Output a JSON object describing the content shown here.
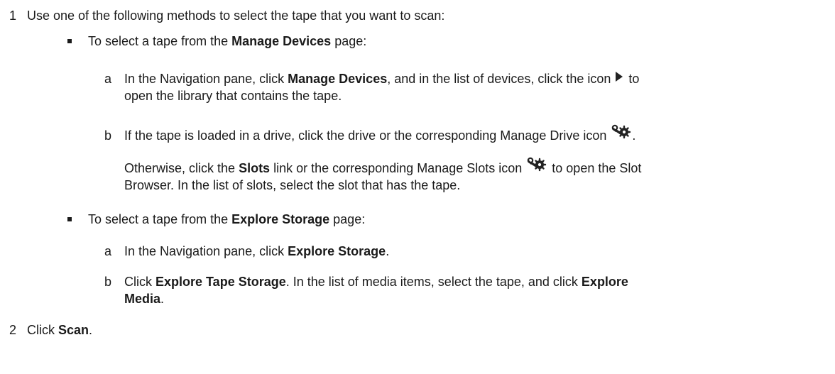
{
  "steps": [
    {
      "number": "1",
      "text": "Use one of the following methods to select the tape that you want to scan:"
    },
    {
      "number": "2",
      "text_before": "Click ",
      "bold": "Scan",
      "text_after": "."
    }
  ],
  "method_manage_devices": {
    "intro_before": "To select a tape from the ",
    "intro_bold": "Manage Devices",
    "intro_after": " page:",
    "step_a": {
      "letter": "a",
      "p1": "In the Navigation pane, click ",
      "b1": "Manage Devices",
      "p2": ", and in the list of devices, click the icon",
      "p3": "to",
      "line2": "open the library that contains the tape."
    },
    "step_b": {
      "letter": "b",
      "line1": "If the tape is loaded in a drive, click the drive or the corresponding Manage Drive icon",
      "line1_end": ".",
      "p1": "Otherwise, click the ",
      "b1": "Slots",
      "p2": " link or the corresponding Manage Slots icon",
      "p3": "to open the Slot",
      "line2": "Browser. In the list of slots, select the slot that has the tape."
    }
  },
  "method_explore_storage": {
    "intro_before": "To select a tape from the ",
    "intro_bold": "Explore Storage",
    "intro_after": " page:",
    "step_a": {
      "letter": "a",
      "p1": "In the Navigation pane, click ",
      "b1": "Explore Storage",
      "p2": "."
    },
    "step_b": {
      "letter": "b",
      "p1": "Click ",
      "b1": "Explore Tape Storage",
      "p2": ". In the list of media items, select the tape, and click ",
      "b2": "Explore",
      "b3": "Media",
      "p3": "."
    }
  },
  "icons": {
    "open_library": "play-arrow-icon",
    "manage_drive": "wrench-gear-icon",
    "manage_slots": "wrench-gear-icon"
  }
}
